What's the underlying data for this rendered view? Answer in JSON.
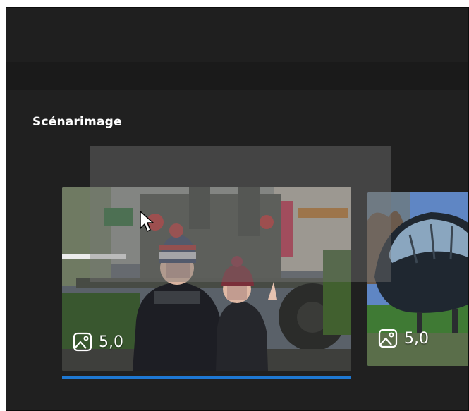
{
  "storyboard": {
    "title": "Scénarimage",
    "clips": [
      {
        "duration": "5,0",
        "type_icon": "image-icon",
        "selected": true
      },
      {
        "duration": "5,0",
        "type_icon": "image-icon",
        "selected": false
      }
    ]
  },
  "colors": {
    "window_bg": "#202020",
    "toolbar_bg": "#1a1a1a",
    "accent": "#1e78d2"
  }
}
